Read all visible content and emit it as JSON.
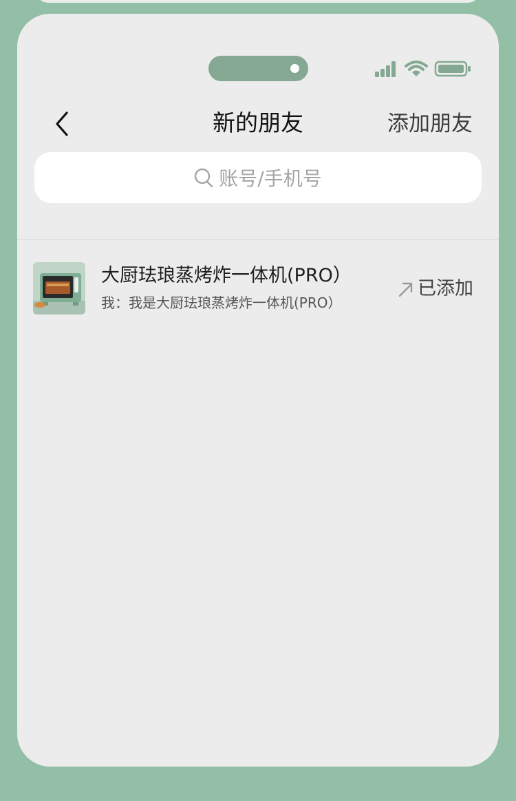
{
  "nav": {
    "title": "新的朋友",
    "action": "添加朋友"
  },
  "search": {
    "placeholder": "账号/手机号"
  },
  "friends": [
    {
      "name": "大厨珐琅蒸烤炸一体机(PRO）",
      "message": "我：我是大厨珐琅蒸烤炸一体机(PRO）",
      "status": "已添加",
      "avatar_icon": "steam-oven-product-photo"
    }
  ],
  "colors": {
    "background": "#92bfa6",
    "phone": "#ececec",
    "accent": "#84a891"
  },
  "icons": [
    "back-chevron-icon",
    "search-icon",
    "arrow-up-right-icon",
    "signal-icon",
    "wifi-icon",
    "battery-icon"
  ]
}
